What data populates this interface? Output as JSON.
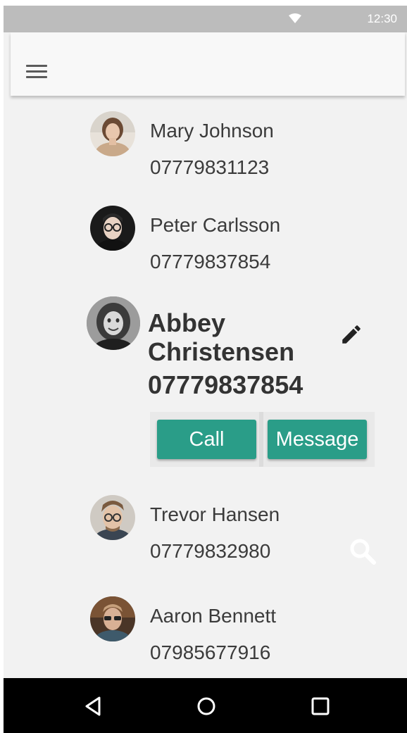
{
  "status_bar": {
    "time": "12:30"
  },
  "contacts": [
    {
      "name": "Mary Johnson",
      "phone": "07779831123"
    },
    {
      "name": "Peter Carlsson",
      "phone": "07779837854"
    },
    {
      "name": "Abbey Christensen",
      "phone": "07779837854"
    },
    {
      "name": "Trevor Hansen",
      "phone": "07779832980"
    },
    {
      "name": "Aaron Bennett",
      "phone": "07985677916"
    }
  ],
  "actions": {
    "call_label": "Call",
    "message_label": "Message"
  },
  "colors": {
    "accent": "#2a9d88",
    "status_bar": "#bcbcbc",
    "nav_bar": "#000000",
    "background": "#f2f2f2"
  },
  "icons": [
    "wifi-icon",
    "menu-icon",
    "edit-icon",
    "search-icon",
    "back-icon",
    "home-icon",
    "recents-icon"
  ]
}
